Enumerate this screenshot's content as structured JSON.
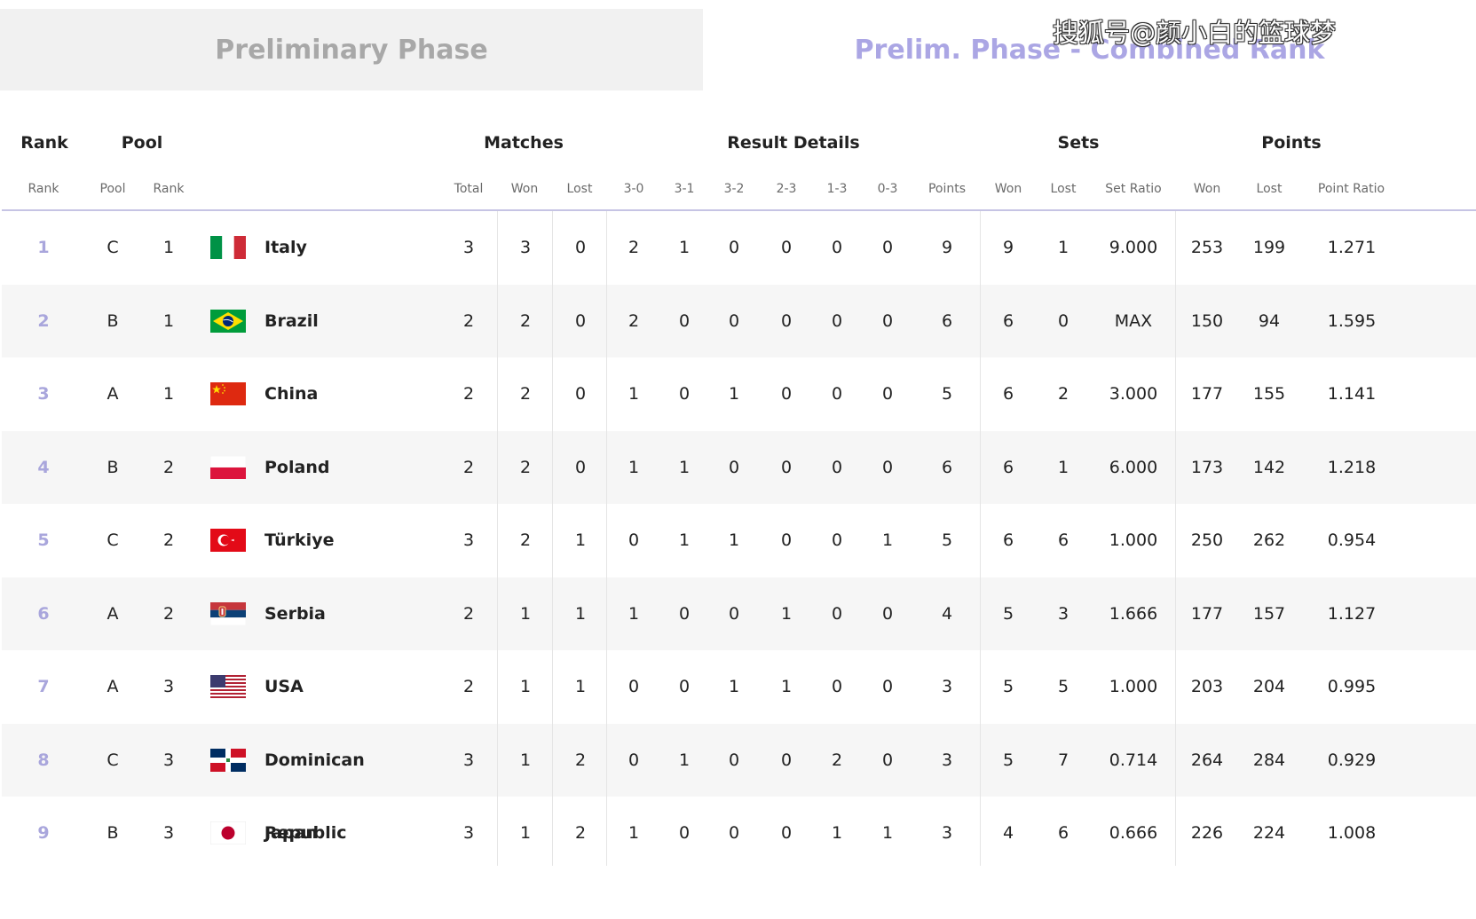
{
  "tabs": {
    "left": "Preliminary Phase",
    "right": "Prelim. Phase - Combined Rank"
  },
  "watermark": "搜狐号@颜小白的篮球梦",
  "group_headers": {
    "rank": "Rank",
    "pool": "Pool",
    "matches": "Matches",
    "result_details": "Result Details",
    "sets": "Sets",
    "points": "Points"
  },
  "sub_headers": {
    "rank": "Rank",
    "pool": "Pool",
    "pool_rank": "Rank",
    "total": "Total",
    "won": "Won",
    "lost": "Lost",
    "r30": "3-0",
    "r31": "3-1",
    "r32": "3-2",
    "r23": "2-3",
    "r13": "1-3",
    "r03": "0-3",
    "pts": "Points",
    "sets_won": "Won",
    "sets_lost": "Lost",
    "set_ratio": "Set Ratio",
    "points_won": "Won",
    "points_lost": "Lost",
    "point_ratio": "Point Ratio"
  },
  "flag_colors": {
    "italy": [
      "#009246",
      "#ffffff",
      "#ce2b37"
    ],
    "brazil": [
      "#009c3b",
      "#ffdf00",
      "#002776"
    ],
    "china": [
      "#de2910",
      "#ffde00"
    ],
    "poland": [
      "#ffffff",
      "#dc143c"
    ],
    "turkiye": [
      "#e30a17",
      "#ffffff"
    ],
    "serbia": [
      "#c6363c",
      "#0c4076",
      "#ffffff"
    ],
    "usa": [
      "#b22234",
      "#ffffff",
      "#3c3b6e"
    ],
    "dominican": [
      "#002d62",
      "#ce1126",
      "#ffffff"
    ],
    "japan": [
      "#ffffff",
      "#bc002d"
    ]
  },
  "rows": [
    {
      "rank": "1",
      "pool": "C",
      "pool_rank": "1",
      "flag": "italy",
      "country": "Italy",
      "total": "3",
      "won": "3",
      "lost": "0",
      "r30": "2",
      "r31": "1",
      "r32": "0",
      "r23": "0",
      "r13": "0",
      "r03": "0",
      "pts": "9",
      "sets_won": "9",
      "sets_lost": "1",
      "set_ratio": "9.000",
      "points_won": "253",
      "points_lost": "199",
      "point_ratio": "1.271"
    },
    {
      "rank": "2",
      "pool": "B",
      "pool_rank": "1",
      "flag": "brazil",
      "country": "Brazil",
      "total": "2",
      "won": "2",
      "lost": "0",
      "r30": "2",
      "r31": "0",
      "r32": "0",
      "r23": "0",
      "r13": "0",
      "r03": "0",
      "pts": "6",
      "sets_won": "6",
      "sets_lost": "0",
      "set_ratio": "MAX",
      "points_won": "150",
      "points_lost": "94",
      "point_ratio": "1.595"
    },
    {
      "rank": "3",
      "pool": "A",
      "pool_rank": "1",
      "flag": "china",
      "country": "China",
      "total": "2",
      "won": "2",
      "lost": "0",
      "r30": "1",
      "r31": "0",
      "r32": "1",
      "r23": "0",
      "r13": "0",
      "r03": "0",
      "pts": "5",
      "sets_won": "6",
      "sets_lost": "2",
      "set_ratio": "3.000",
      "points_won": "177",
      "points_lost": "155",
      "point_ratio": "1.141"
    },
    {
      "rank": "4",
      "pool": "B",
      "pool_rank": "2",
      "flag": "poland",
      "country": "Poland",
      "total": "2",
      "won": "2",
      "lost": "0",
      "r30": "1",
      "r31": "1",
      "r32": "0",
      "r23": "0",
      "r13": "0",
      "r03": "0",
      "pts": "6",
      "sets_won": "6",
      "sets_lost": "1",
      "set_ratio": "6.000",
      "points_won": "173",
      "points_lost": "142",
      "point_ratio": "1.218"
    },
    {
      "rank": "5",
      "pool": "C",
      "pool_rank": "2",
      "flag": "turkiye",
      "country": "Türkiye",
      "total": "3",
      "won": "2",
      "lost": "1",
      "r30": "0",
      "r31": "1",
      "r32": "1",
      "r23": "0",
      "r13": "0",
      "r03": "1",
      "pts": "5",
      "sets_won": "6",
      "sets_lost": "6",
      "set_ratio": "1.000",
      "points_won": "250",
      "points_lost": "262",
      "point_ratio": "0.954"
    },
    {
      "rank": "6",
      "pool": "A",
      "pool_rank": "2",
      "flag": "serbia",
      "country": "Serbia",
      "total": "2",
      "won": "1",
      "lost": "1",
      "r30": "1",
      "r31": "0",
      "r32": "0",
      "r23": "1",
      "r13": "0",
      "r03": "0",
      "pts": "4",
      "sets_won": "5",
      "sets_lost": "3",
      "set_ratio": "1.666",
      "points_won": "177",
      "points_lost": "157",
      "point_ratio": "1.127"
    },
    {
      "rank": "7",
      "pool": "A",
      "pool_rank": "3",
      "flag": "usa",
      "country": "USA",
      "total": "2",
      "won": "1",
      "lost": "1",
      "r30": "0",
      "r31": "0",
      "r32": "1",
      "r23": "1",
      "r13": "0",
      "r03": "0",
      "pts": "3",
      "sets_won": "5",
      "sets_lost": "5",
      "set_ratio": "1.000",
      "points_won": "203",
      "points_lost": "204",
      "point_ratio": "0.995"
    },
    {
      "rank": "8",
      "pool": "C",
      "pool_rank": "3",
      "flag": "dominican",
      "country": "Dominican Republic",
      "total": "3",
      "won": "1",
      "lost": "2",
      "r30": "0",
      "r31": "1",
      "r32": "0",
      "r23": "0",
      "r13": "2",
      "r03": "0",
      "pts": "3",
      "sets_won": "5",
      "sets_lost": "7",
      "set_ratio": "0.714",
      "points_won": "264",
      "points_lost": "284",
      "point_ratio": "0.929"
    },
    {
      "rank": "9",
      "pool": "B",
      "pool_rank": "3",
      "flag": "japan",
      "country": "Japan",
      "total": "3",
      "won": "1",
      "lost": "2",
      "r30": "1",
      "r31": "0",
      "r32": "0",
      "r23": "0",
      "r13": "1",
      "r03": "1",
      "pts": "3",
      "sets_won": "4",
      "sets_lost": "6",
      "set_ratio": "0.666",
      "points_won": "226",
      "points_lost": "224",
      "point_ratio": "1.008"
    }
  ]
}
